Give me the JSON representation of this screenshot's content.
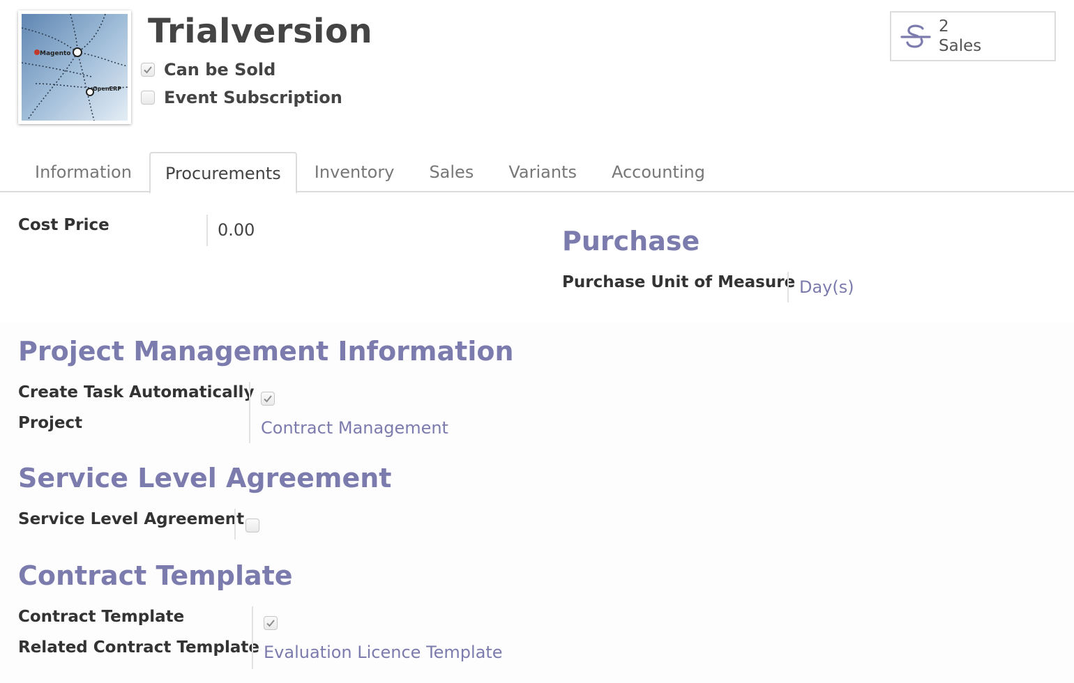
{
  "product": {
    "title": "Trialversion",
    "image_alt": "Magento OpenERP connector image",
    "image_texts": [
      "Magento",
      "OpenERP"
    ],
    "flags": [
      {
        "label": "Can be Sold",
        "checked": true
      },
      {
        "label": "Event Subscription",
        "checked": false
      }
    ]
  },
  "stat_button": {
    "count": "2",
    "label": "Sales",
    "icon": "strikethrough-s-icon"
  },
  "tabs": [
    {
      "label": "Information",
      "active": false
    },
    {
      "label": "Procurements",
      "active": true
    },
    {
      "label": "Inventory",
      "active": false
    },
    {
      "label": "Sales",
      "active": false
    },
    {
      "label": "Variants",
      "active": false
    },
    {
      "label": "Accounting",
      "active": false
    }
  ],
  "procurements": {
    "cost_price": {
      "label": "Cost Price",
      "value": "0.00"
    },
    "purchase": {
      "title": "Purchase",
      "uom": {
        "label": "Purchase Unit of Measure",
        "value": "Day(s)"
      }
    }
  },
  "project_management": {
    "title": "Project Management Information",
    "create_task": {
      "label": "Create Task Automatically",
      "checked": true
    },
    "project": {
      "label": "Project",
      "value": "Contract Management"
    }
  },
  "sla": {
    "title": "Service Level Agreement",
    "field": {
      "label": "Service Level Agreement",
      "checked": false
    }
  },
  "contract_template": {
    "title": "Contract Template",
    "field": {
      "label": "Contract Template",
      "checked": true
    },
    "related": {
      "label": "Related Contract Template",
      "value": "Evaluation Licence Template"
    }
  },
  "colors": {
    "accent": "#7c7bad",
    "label": "#333333",
    "border": "#dcdcdc"
  }
}
